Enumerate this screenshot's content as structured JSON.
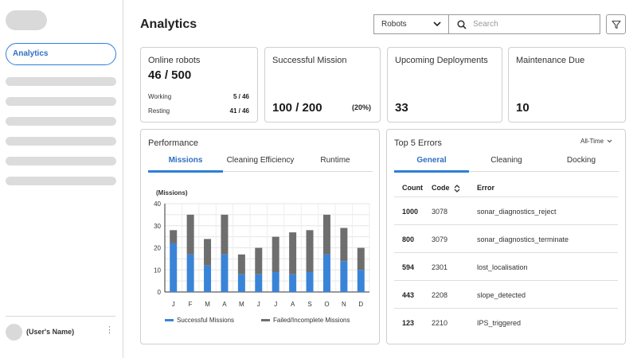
{
  "sidebar": {
    "active_item": "Analytics",
    "user_name": "(User's Name)",
    "user_menu_glyph": "⋮"
  },
  "header": {
    "title": "Analytics",
    "select_value": "Robots",
    "search_placeholder": "Search"
  },
  "stats": {
    "online": {
      "label": "Online robots",
      "value": "46 / 500",
      "working_label": "Working",
      "working_value": "5 / 46",
      "resting_label": "Resting",
      "resting_value": "41 / 46"
    },
    "mission": {
      "label": "Successful Mission",
      "value": "100 / 200",
      "percent": "(20%)"
    },
    "deploy": {
      "label": "Upcoming Deployments",
      "value": "33"
    },
    "maint": {
      "label": "Maintenance Due",
      "value": "10"
    }
  },
  "performance": {
    "title": "Performance",
    "tabs": [
      "Missions",
      "Cleaning Efficiency",
      "Runtime"
    ],
    "active_tab": 0
  },
  "chart_data": {
    "type": "bar",
    "stacked": true,
    "ylabel": "(Missions)",
    "ylim": [
      0,
      40
    ],
    "yticks": [
      0,
      5,
      10,
      15,
      20,
      25,
      30,
      35,
      40
    ],
    "categories": [
      "J",
      "F",
      "M",
      "A",
      "M",
      "J",
      "J",
      "A",
      "S",
      "O",
      "N",
      "D"
    ],
    "series": [
      {
        "name": "Successful Missions",
        "color": "#3a84d8",
        "values": [
          22,
          17,
          12,
          17,
          8,
          8,
          9,
          8,
          9,
          17,
          14,
          10
        ]
      },
      {
        "name": "Failed/Incomplete Missions",
        "color": "#6e6e6e",
        "values": [
          6,
          18,
          12,
          18,
          9,
          12,
          16,
          19,
          19,
          18,
          15,
          10
        ]
      }
    ],
    "grid": true,
    "legend": "bottom"
  },
  "errors": {
    "title": "Top 5 Errors",
    "range": "All-Time",
    "tabs": [
      "General",
      "Cleaning",
      "Docking"
    ],
    "active_tab": 0,
    "columns": [
      "Count",
      "Code",
      "Error"
    ],
    "rows": [
      {
        "count": "1000",
        "code": "3078",
        "error": "sonar_diagnostics_reject"
      },
      {
        "count": "800",
        "code": "3079",
        "error": "sonar_diagnostics_terminate"
      },
      {
        "count": "594",
        "code": "2301",
        "error": "lost_localisation"
      },
      {
        "count": "443",
        "code": "2208",
        "error": "slope_detected"
      },
      {
        "count": "123",
        "code": "2210",
        "error": "IPS_triggered"
      }
    ]
  }
}
